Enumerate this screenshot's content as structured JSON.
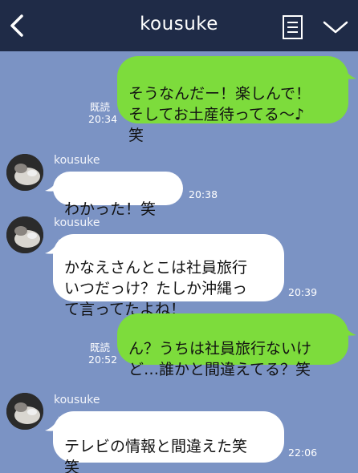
{
  "header": {
    "title": "kousuke"
  },
  "messages": [
    {
      "direction": "out",
      "text": "そうなんだー！楽しんで！\nそしてお土産待ってる〜♪\n笑",
      "read": "既読",
      "time": "20:34"
    },
    {
      "direction": "in",
      "sender": "kousuke",
      "text": "わかった！笑",
      "time": "20:38"
    },
    {
      "direction": "in",
      "sender": "kousuke",
      "text": "かなえさんとこは社員旅行\nいつだっけ？たしか沖縄っ\nて言ってたよね！",
      "time": "20:39"
    },
    {
      "direction": "out",
      "text": "ん？うちは社員旅行ないけ\nど…誰かと間違えてる？笑",
      "read": "既読",
      "time": "20:52"
    },
    {
      "direction": "in",
      "sender": "kousuke",
      "text": "テレビの情報と間違えた笑\n笑",
      "time": "22:06"
    }
  ],
  "colors": {
    "background": "#7b93c4",
    "header": "#1f2b47",
    "outgoing_bubble": "#7ddc3c",
    "incoming_bubble": "#ffffff"
  },
  "icons": {
    "back": "chevron-left-icon",
    "notes": "notes-icon",
    "menu": "chevron-down-icon"
  }
}
